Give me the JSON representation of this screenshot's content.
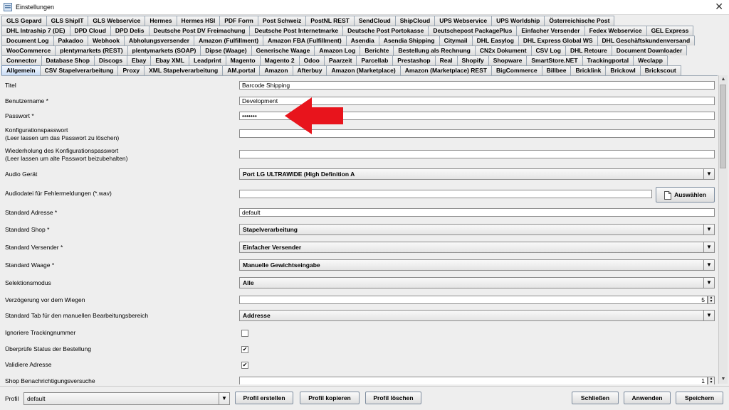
{
  "window": {
    "title": "Einstellungen",
    "close_glyph": "✕"
  },
  "tabs": {
    "rows": [
      [
        "GLS Gepard",
        "GLS ShipIT",
        "GLS Webservice",
        "Hermes",
        "Hermes HSI",
        "PDF Form",
        "Post Schweiz",
        "PostNL REST",
        "SendCloud",
        "ShipCloud",
        "UPS Webservice",
        "UPS Worldship",
        "Österreichische Post"
      ],
      [
        "DHL Intraship 7 (DE)",
        "DPD Cloud",
        "DPD Delis",
        "Deutsche Post DV Freimachung",
        "Deutsche Post Internetmarke",
        "Deutsche Post Portokasse",
        "Deutschepost PackagePlus",
        "Einfacher Versender",
        "Fedex Webservice",
        "GEL Express"
      ],
      [
        "Document Log",
        "Pakadoo",
        "Webhook",
        "Abholungsversender",
        "Amazon (Fulfillment)",
        "Amazon FBA (Fulfillment)",
        "Asendia",
        "Asendia Shipping",
        "Citymail",
        "DHL Easylog",
        "DHL Express Global WS",
        "DHL Geschäftskundenversand"
      ],
      [
        "WooCommerce",
        "plentymarkets (REST)",
        "plentymarkets (SOAP)",
        "Dipse (Waage)",
        "Generische Waage",
        "Amazon Log",
        "Berichte",
        "Bestellung als Rechnung",
        "CN2x Dokument",
        "CSV Log",
        "DHL Retoure",
        "Document Downloader"
      ],
      [
        "Connector",
        "Database Shop",
        "Discogs",
        "Ebay",
        "Ebay XML",
        "Leadprint",
        "Magento",
        "Magento 2",
        "Odoo",
        "Paarzeit",
        "Parcellab",
        "Prestashop",
        "Real",
        "Shopify",
        "Shopware",
        "SmartStore.NET",
        "Trackingportal",
        "Weclapp"
      ],
      [
        "Allgemein",
        "CSV Stapelverarbeitung",
        "Proxy",
        "XML Stapelverarbeitung",
        "AM.portal",
        "Amazon",
        "Afterbuy",
        "Amazon (Marketplace)",
        "Amazon (Marketplace) REST",
        "BigCommerce",
        "Billbee",
        "Bricklink",
        "Brickowl",
        "Brickscout"
      ]
    ],
    "active": "Allgemein"
  },
  "form": {
    "titel": {
      "label": "Titel",
      "value": "Barcode Shipping"
    },
    "benutzername": {
      "label": "Benutzername *",
      "value": "Development"
    },
    "passwort": {
      "label": "Passwort *",
      "value": "•••••••"
    },
    "konfig_passwort": {
      "label1": "Konfigurationspasswort",
      "label2": "(Leer lassen um das Passwort zu löschen)",
      "value": ""
    },
    "konfig_wiederholung": {
      "label1": "Wiederholung des Konfigurationspasswort",
      "label2": "(Leer lassen um alte Passwort beizubehalten)",
      "value": ""
    },
    "audio_geraet": {
      "label": "Audio Gerät",
      "value": "Port LG ULTRAWIDE (High Definition A"
    },
    "audiodatei": {
      "label": "Audiodatei für Fehlermeldungen (*.wav)",
      "value": "",
      "button": "Auswählen"
    },
    "standard_adresse": {
      "label": "Standard Adresse *",
      "value": "default"
    },
    "standard_shop": {
      "label": "Standard Shop *",
      "value": "Stapelverarbeitung"
    },
    "standard_versender": {
      "label": "Standard Versender *",
      "value": "Einfacher Versender"
    },
    "standard_waage": {
      "label": "Standard Waage *",
      "value": "Manuelle Gewichtseingabe"
    },
    "selektionsmodus": {
      "label": "Selektionsmodus",
      "value": "Alle"
    },
    "verzoegerung": {
      "label": "Verzögerung vor dem Wiegen",
      "value": "5"
    },
    "standard_tab": {
      "label": "Standard Tab für den manuellen Bearbeitungsbereich",
      "value": "Addresse"
    },
    "ignoriere_tracking": {
      "label": "Ignoriere Trackingnummer",
      "checked": false
    },
    "ueberpruefe_status": {
      "label": "Überprüfe Status der Bestellung",
      "checked": true
    },
    "validiere_adresse": {
      "label": "Validiere Adresse",
      "checked": true
    },
    "shop_benachrichtigung": {
      "label": "Shop Benachrichtigungsversuche",
      "value": "1"
    }
  },
  "bottom": {
    "profil_label": "Profil",
    "profil_value": "default",
    "buttons": {
      "erstellen": "Profil erstellen",
      "kopieren": "Profil kopieren",
      "loeschen": "Profil löschen",
      "schliessen": "Schließen",
      "anwenden": "Anwenden",
      "speichern": "Speichern"
    }
  },
  "glyphs": {
    "dropdown": "▼",
    "check": "✔",
    "spin_up": "▲",
    "spin_down": "▼",
    "scroll_up": "▲",
    "scroll_down": "▼"
  },
  "icons": {
    "window": "app-window-icon",
    "file": "file-icon",
    "annotation": "red-arrow-icon"
  },
  "colors": {
    "annotation_arrow": "#e8141c",
    "active_tab": "#c9dcf5"
  }
}
